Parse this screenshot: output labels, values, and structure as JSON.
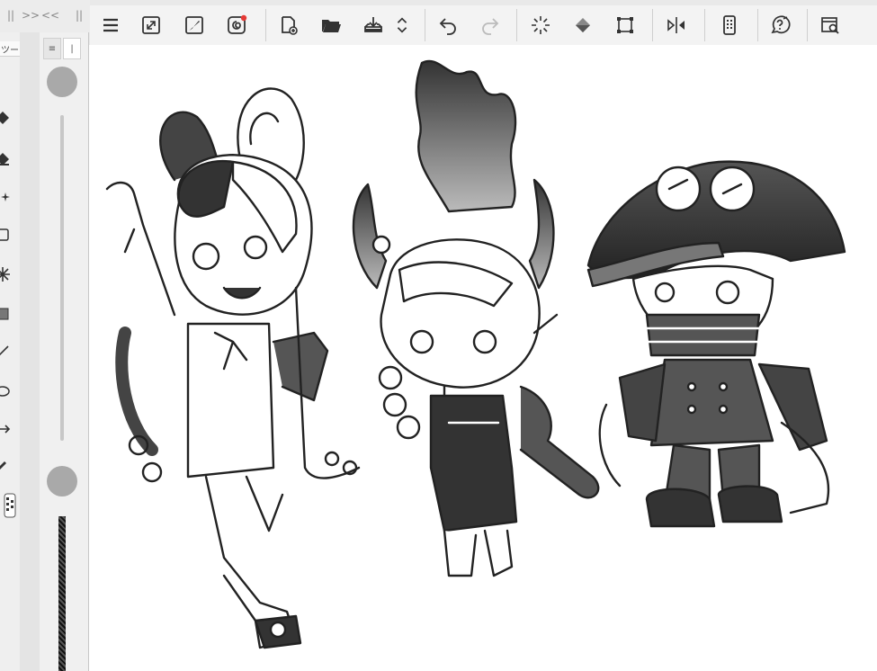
{
  "app": {
    "panel_strip": {
      "pin_glyph": "||",
      "expand_glyph": ">>",
      "collapse_glyph": "<<",
      "pin_glyph2": "||"
    },
    "tool_panel": {
      "tab_label": "ツー"
    },
    "brush_panel": {
      "tab1_glyph": "≡",
      "tab2_glyph": "|"
    }
  },
  "toolbar": {
    "buttons": [
      {
        "name": "menu-button",
        "icon": "hamburger-menu-icon"
      },
      {
        "name": "fullscreen-button",
        "icon": "expand-icon"
      },
      {
        "name": "edit-brush-button",
        "icon": "brush-edit-icon"
      },
      {
        "name": "assets-button",
        "icon": "spiral-notification-icon"
      },
      {
        "name": "new-canvas-button",
        "icon": "new-document-icon"
      },
      {
        "name": "open-button",
        "icon": "folder-open-icon"
      },
      {
        "name": "save-button",
        "icon": "save-tray-icon"
      },
      {
        "name": "more-arrows-button",
        "icon": "up-down-chevron-icon"
      },
      {
        "name": "undo-button",
        "icon": "undo-icon"
      },
      {
        "name": "redo-button",
        "icon": "redo-icon"
      },
      {
        "name": "clear-button",
        "icon": "loading-sparkle-icon"
      },
      {
        "name": "fill-button",
        "icon": "fill-bucket-icon"
      },
      {
        "name": "transform-button",
        "icon": "transform-crop-icon"
      },
      {
        "name": "flip-button",
        "icon": "flip-horizontal-icon"
      },
      {
        "name": "smartphone-button",
        "icon": "smartphone-icon"
      },
      {
        "name": "help-button",
        "icon": "help-icon"
      },
      {
        "name": "search-window-button",
        "icon": "window-search-icon"
      }
    ]
  },
  "colors": {
    "accent_dot": "#e53935",
    "ink": "#333333",
    "panel_bg": "#f0f0f0"
  }
}
